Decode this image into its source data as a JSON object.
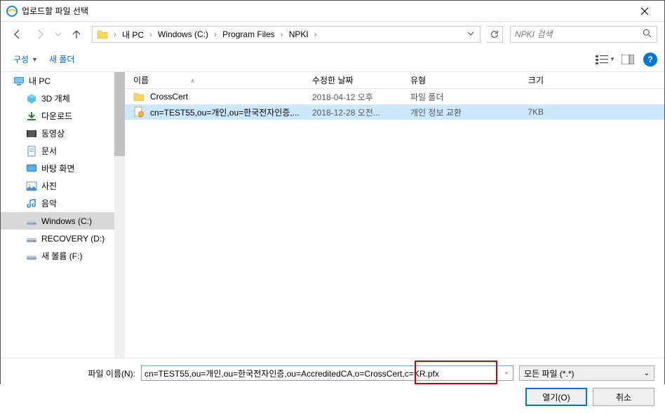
{
  "title": "업로드할 파일 선택",
  "breadcrumb": [
    "내 PC",
    "Windows (C:)",
    "Program Files",
    "NPKI"
  ],
  "search_placeholder": "NPKI 검색",
  "toolbar": {
    "organize": "구성",
    "new_folder": "새 폴더"
  },
  "sidebar": {
    "items": [
      {
        "label": "내 PC",
        "icon": "pc",
        "child": false,
        "selected": false
      },
      {
        "label": "3D 개체",
        "icon": "3d",
        "child": true,
        "selected": false
      },
      {
        "label": "다운로드",
        "icon": "download",
        "child": true,
        "selected": false
      },
      {
        "label": "동영상",
        "icon": "video",
        "child": true,
        "selected": false
      },
      {
        "label": "문서",
        "icon": "doc",
        "child": true,
        "selected": false
      },
      {
        "label": "바탕 화면",
        "icon": "desktop",
        "child": true,
        "selected": false
      },
      {
        "label": "사진",
        "icon": "photo",
        "child": true,
        "selected": false
      },
      {
        "label": "음악",
        "icon": "music",
        "child": true,
        "selected": false
      },
      {
        "label": "Windows (C:)",
        "icon": "drive",
        "child": true,
        "selected": true
      },
      {
        "label": "RECOVERY (D:)",
        "icon": "drive",
        "child": true,
        "selected": false
      },
      {
        "label": "새 볼륨 (F:)",
        "icon": "drive",
        "child": true,
        "selected": false
      }
    ]
  },
  "columns": {
    "name": "이름",
    "date": "수정한 날짜",
    "type": "유형",
    "size": "크기"
  },
  "files": [
    {
      "name": "CrossCert",
      "date": "2018-04-12 오후",
      "type": "파일 폴더",
      "size": "",
      "icon": "folder",
      "selected": false
    },
    {
      "name": "cn=TEST55,ou=개인,ou=한국전자인증,...",
      "date": "2018-12-28 오전...",
      "type": "개인 정보 교환",
      "size": "7KB",
      "icon": "cert",
      "selected": true
    }
  ],
  "footer": {
    "filename_label": "파일 이름(N):",
    "filename_value": "cn=TEST55,ou=개인,ou=한국전자인증,ou=AccreditedCA,o=CrossCert,c=KR.pfx",
    "filetype": "모든 파일 (*.*)",
    "open": "열기(O)",
    "cancel": "취소"
  }
}
